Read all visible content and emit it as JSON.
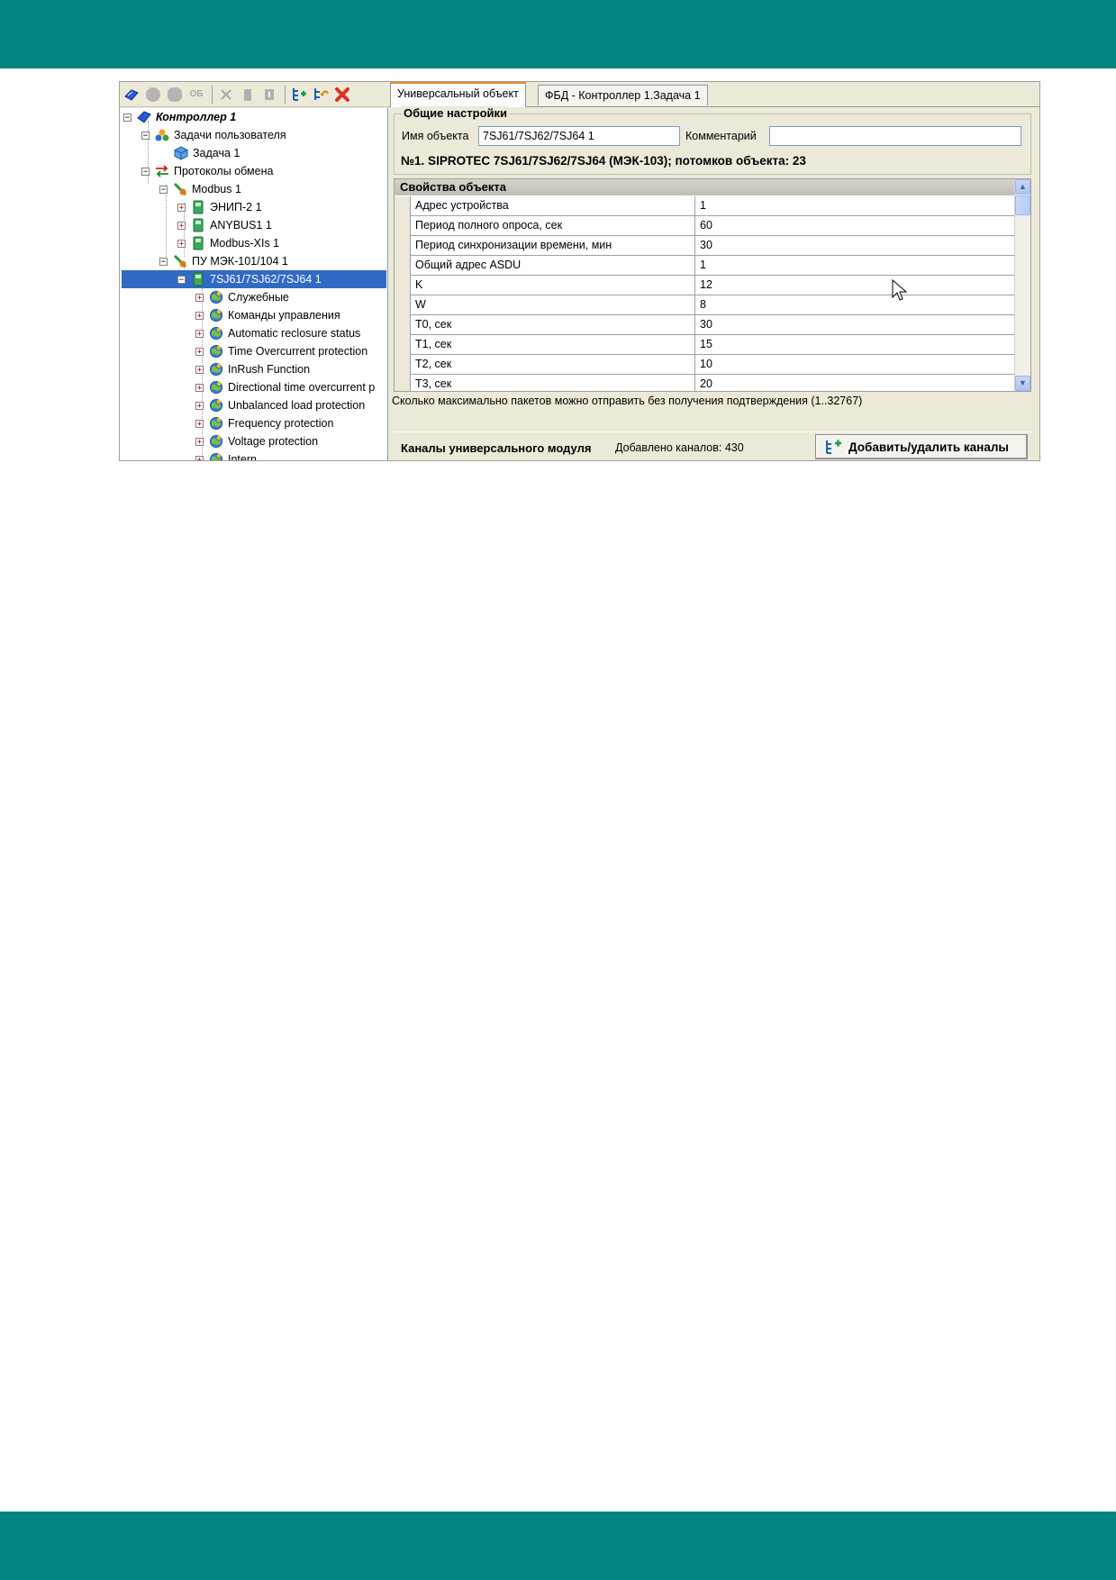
{
  "colors": {
    "band": "#008580",
    "selection": "#316ac5",
    "tab_accent": "#e68b2c"
  },
  "toolbar": {
    "icons": [
      "controller-icon",
      "add-icon",
      "add-group-icon",
      "ob-icon",
      "cut-icon",
      "delete-icon",
      "properties-icon",
      "tree-add-icon",
      "tree-undo-icon",
      "close-icon"
    ],
    "ob_label": "ОБ"
  },
  "tree": {
    "root": "Контроллер 1",
    "tasks": "Задачи пользователя",
    "task1": "Задача 1",
    "protocols": "Протоколы обмена",
    "modbus": "Modbus 1",
    "znip": "ЭНИП-2 1",
    "anybus": "ANYBUS1 1",
    "modbusxls": "Modbus-XIs 1",
    "pu": "ПУ МЭК-101/104 1",
    "device": "7SJ61/7SJ62/7SJ64 1",
    "children": [
      "Служебные",
      "Команды управления",
      "Automatic reclosure status",
      "Time Overcurrent protection",
      "InRush Function",
      "Directional time overcurrent p",
      "Unbalanced load protection",
      "Frequency protection",
      "Voltage protection",
      "Intern..."
    ]
  },
  "tabs": [
    "Универсальный объект",
    "ФБД - Контроллер 1.Задача 1"
  ],
  "general": {
    "title": "Общие настройки",
    "name_label": "Имя объекта",
    "name_value": "7SJ61/7SJ62/7SJ64 1",
    "comment_label": "Комментарий",
    "comment_value": "",
    "object_info": "№1. SIPROTEC 7SJ61/7SJ62/7SJ64 (МЭК-103); потомков объекта: 23"
  },
  "properties": {
    "title": "Свойства объекта",
    "rows": [
      {
        "key": "Адрес устройства",
        "value": "1"
      },
      {
        "key": "Период полного опроса, сек",
        "value": "60"
      },
      {
        "key": "Период синхронизации времени, мин",
        "value": "30"
      },
      {
        "key": "Общий адрес ASDU",
        "value": "1"
      },
      {
        "key": "K",
        "value": "12"
      },
      {
        "key": "W",
        "value": "8"
      },
      {
        "key": "T0, сек",
        "value": "30"
      },
      {
        "key": "T1, сек",
        "value": "15"
      },
      {
        "key": "T2, сек",
        "value": "10"
      },
      {
        "key": "T3, сек",
        "value": "20"
      }
    ]
  },
  "hint": "Сколько максимально пакетов можно отправить без получения подтверждения (1..32767)",
  "channels": {
    "title": "Каналы универсального модуля",
    "count": "Добавлено каналов: 430",
    "button": "Добавить/удалить каналы"
  }
}
